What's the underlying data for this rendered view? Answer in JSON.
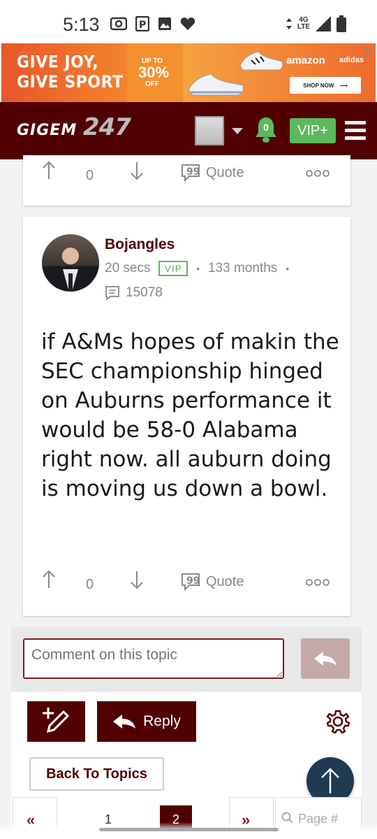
{
  "status_bar": {
    "time": "5:13",
    "network_top": "4G",
    "network_bottom": "LTE"
  },
  "ad": {
    "headline_1": "GIVE JOY,",
    "headline_2": "GIVE SPORT",
    "upto": "UP TO",
    "percent": "30%",
    "off": "OFF",
    "brand_1": "amazon",
    "brand_2": "adidas",
    "cta": "SHOP NOW"
  },
  "header": {
    "logo_text": "GIGEM",
    "logo_number": "247",
    "notification_count": "0",
    "vip_label": "VIP+"
  },
  "previous_post": {
    "vote_count": "0",
    "quote_label": "Quote"
  },
  "post": {
    "username": "Bojangles",
    "time_ago": "20 secs",
    "badge": "VIP",
    "member_for": "133 months",
    "post_count": "15078",
    "body": "if A&Ms hopes of makin the SEC championship hinged on Auburns performance it would be 58-0 Alabama right now. all auburn doing is moving us down a bowl.",
    "vote_count": "0",
    "quote_label": "Quote"
  },
  "comment": {
    "placeholder": "Comment on this topic"
  },
  "actions": {
    "reply_label": "Reply",
    "back_label": "Back To Topics"
  },
  "pagination": {
    "page_1": "1",
    "current_page": "2",
    "search_placeholder": "Page #"
  },
  "colors": {
    "brand": "#500000",
    "vip_green": "#5cb85c",
    "fab": "#1f3a52"
  }
}
